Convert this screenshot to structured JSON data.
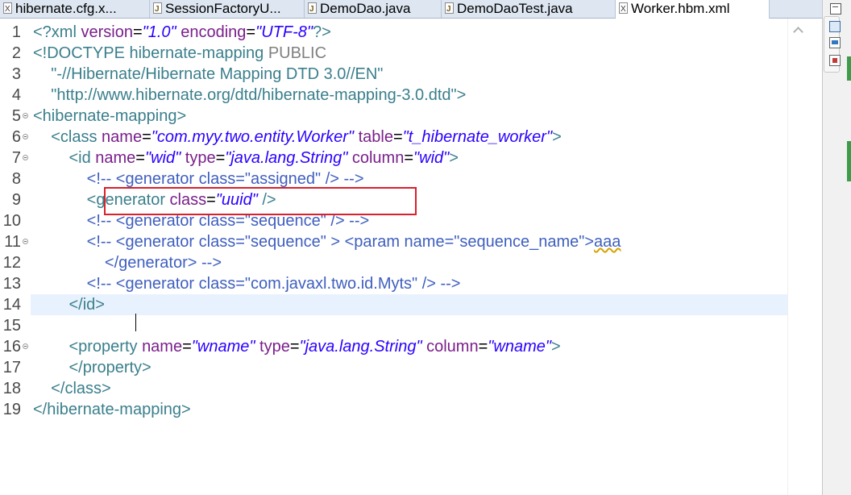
{
  "tabs": [
    {
      "label": "hibernate.cfg.x...",
      "icon": "xml-file-icon"
    },
    {
      "label": "SessionFactoryU...",
      "icon": "java-file-icon"
    },
    {
      "label": "DemoDao.java",
      "icon": "java-file-icon"
    },
    {
      "label": "DemoDaoTest.java",
      "icon": "java-file-icon"
    },
    {
      "label": "Worker.hbm.xml",
      "icon": "xml-file-icon",
      "active": true
    }
  ],
  "editor": {
    "line_numbers": [
      "1",
      "2",
      "3",
      "4",
      "5",
      "6",
      "7",
      "8",
      "9",
      "10",
      "11",
      "12",
      "13",
      "14",
      "15",
      "16",
      "17",
      "18",
      "19"
    ],
    "lines": {
      "l1": {
        "a": "<?xml ",
        "b": "version",
        "c": "=",
        "d": "\"1.0\"",
        "e": " encoding",
        "f": "=",
        "g": "\"UTF-8\"",
        "h": "?>"
      },
      "l2": {
        "a": "<!DOCTYPE hibernate-mapping ",
        "b": "PUBLIC"
      },
      "l3": {
        "a": "    \"-//Hibernate/Hibernate Mapping DTD 3.0//EN\""
      },
      "l4": {
        "a": "    \"http://www.hibernate.org/dtd/hibernate-mapping-3.0.dtd\"",
        "b": ">"
      },
      "l5": {
        "a": "<hibernate-mapping>"
      },
      "l6": {
        "a": "    <class ",
        "b": "name",
        "c": "=",
        "d": "\"com.myy.two.entity.Worker\"",
        "e": " table",
        "f": "=",
        "g": "\"t_hibernate_worker\"",
        "h": ">"
      },
      "l7": {
        "a": "        <id ",
        "b": "name",
        "c": "=",
        "d": "\"wid\"",
        "e": " type",
        "f": "=",
        "g": "\"java.lang.String\"",
        "h": " column",
        "i": "=",
        "j": "\"wid\"",
        "k": ">"
      },
      "l8": {
        "a": "            <!-- <generator class=\"assigned\" /> -->"
      },
      "l9": {
        "a": "            <generator ",
        "b": "class",
        "c": "=",
        "d": "\"uuid\"",
        "e": " />"
      },
      "l10": {
        "a": "            <!-- <generator class=\"sequence\" /> -->"
      },
      "l11": {
        "a": "            <!-- <generator class=\"sequence\" > <param name=\"sequence_name\">",
        "b": "aaa"
      },
      "l12": {
        "a": "                </generator> -->"
      },
      "l13": {
        "a": "            <!-- <generator class=\"com.javaxl.two.id.Myts\" /> -->"
      },
      "l14": {
        "a": "        </id>"
      },
      "l15": {
        "a": ""
      },
      "l16": {
        "a": "        <property ",
        "b": "name",
        "c": "=",
        "d": "\"wname\"",
        "e": " type",
        "f": "=",
        "g": "\"java.lang.String\"",
        "h": " column",
        "i": "=",
        "j": "\"wname\"",
        "k": ">"
      },
      "l17": {
        "a": "        </property>"
      },
      "l18": {
        "a": "    </class>"
      },
      "l19": {
        "a": "</hibernate-mapping>"
      }
    },
    "fold_lines": [
      5,
      6,
      7,
      11,
      16
    ],
    "current_line": 14,
    "highlighted_line": 9
  },
  "colors": {
    "tag": "#3a7f8c",
    "attribute_name": "#7a1f8b",
    "attribute_value": "#2a00ff",
    "comment": "#3f5fbf",
    "highlight_box": "#d9202b",
    "current_line_bg": "#e8f2fe"
  }
}
